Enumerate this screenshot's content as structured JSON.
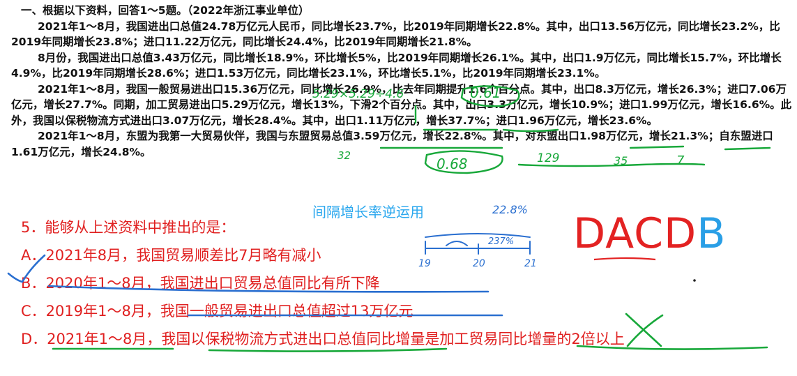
{
  "passage": {
    "title": "一、根据以下资料，回答1～5题。（2022年浙江事业单位）",
    "paragraphs": [
      "2021年1～8月，我国进出口总值24.78万亿元人民币，同比增长23.7%，比2019年同期增长22.8%。其中，出口13.56万亿元，同比增长23.2%，比2019年同期增长23.8%；进口11.22万亿元，同比增长24.4%，比2019年同期增长21.8%。",
      "8月份，我国进出口总值3.43万亿元，同比增长18.9%，环比增长5%，比2019年同期增长26.1%。其中，出口1.9万亿元，同比增长15.7%，环比增长4.9%，比2019年同期增长28.6%；进口1.53万亿元，同比增长23.1%，环比增长5.1%，比2019年同期增长23.1%。",
      "2021年1～8月，我国一般贸易进出口15.36万亿元，同比增长26.9%，比去年同期提升1.6个百分点。其中，出口8.3万亿元，增长26.3%；进口7.06万亿元，增长27.7%。同期，加工贸易进出口5.29万亿元，增长13%，下滑2个百分点。其中，出口3.3万亿元，增长10.9%；进口1.99万亿元，增长16.6%。此外，我国以保税物流方式进出口3.07万亿元，增长28.4%。其中，出口1.11万亿元，增长37.7%；进口1.96万亿元，增长23.6%。",
      "2021年1～8月，东盟为我第一大贸易伙伴，我国与东盟贸易总值3.59万亿元，增长22.8%。其中，对东盟出口1.98万亿元，增长21.3%；自东盟进口1.61万亿元，增长24.8%。"
    ]
  },
  "question": {
    "stem": "5．能够从上述资料中推出的是：",
    "options": [
      "A．2021年8月，我国贸易顺差比7月略有减小",
      "B．2020年1～8月，我国进出口贸易总值同比有所下降",
      "C．2019年1～8月，我国一般贸易进出口总值超过13万亿元",
      "D．2021年1～8月，我国以保税物流方式进出口总值同比增量是加工贸易同比增量的2倍以上"
    ]
  },
  "annotations": {
    "note": "间隔增长率逆运用",
    "answer_key_red": "DACD",
    "answer_key_blue": "B",
    "handwritten": {
      "top_formula": "5.29×5.29÷4.6",
      "ratio_top": "0.61",
      "ratio_bottom": "0.68",
      "val_32": "32",
      "val_129": "129",
      "val_35": "35",
      "val_7": "7",
      "val_228": "22.8%",
      "timeline_mid": "237%",
      "year_19": "19",
      "year_20": "20",
      "year_21": "21"
    },
    "colors": {
      "red": "#e32222",
      "green": "#18a83a",
      "blue": "#2a9fe6"
    }
  }
}
